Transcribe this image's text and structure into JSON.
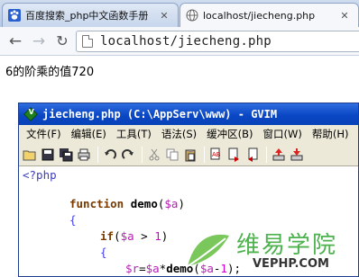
{
  "browser": {
    "tabs": [
      {
        "title": "百度搜索_php中文函数手册",
        "active": false,
        "favicon": "baidu-paw-icon"
      },
      {
        "title": "localhost/jiecheng.php",
        "active": true,
        "favicon": "globe-icon"
      }
    ],
    "address": "localhost/jiecheng.php"
  },
  "page": {
    "output": "6的阶乘的值720"
  },
  "gvim": {
    "title": "jiecheng.php (C:\\AppServ\\www) - GVIM",
    "menu": [
      "文件(F)",
      "编辑(E)",
      "工具(T)",
      "语法(S)",
      "缓冲区(B)",
      "窗口(W)",
      "帮助(H)"
    ],
    "code": {
      "open_tag": "<?php",
      "function_kw": "function",
      "function_name": "demo",
      "param": "$a",
      "brace_open": "{",
      "if_kw": "if",
      "if_var": "$a",
      "if_op": " > ",
      "if_num": "1",
      "inner_brace": "{",
      "assign_var": "$r",
      "assign_rhs_var": "$a",
      "assign_fn": "demo",
      "assign_arg": "$a",
      "assign_num": "1"
    }
  },
  "watermark": {
    "cn": "维易学院",
    "en": "VEPHP.COM",
    "color": "#4db24d"
  },
  "colors": {
    "gvim_title": "#0a47c4",
    "php_tag": "#3c3cbe",
    "variable": "#b31fb3",
    "keyword": "#7a3a00"
  }
}
